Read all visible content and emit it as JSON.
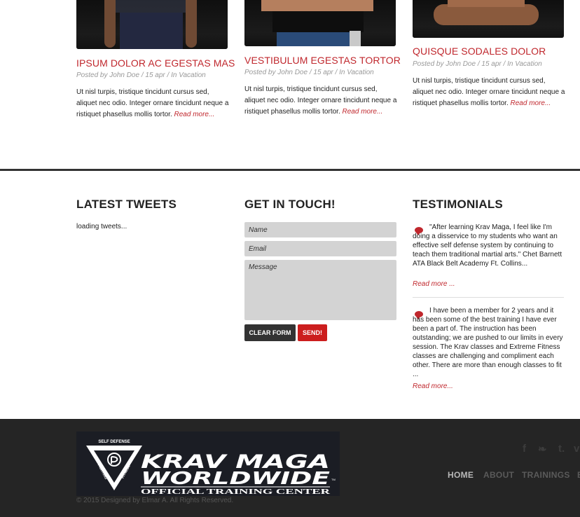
{
  "posts": [
    {
      "title": "IPSUM DOLOR AC EGESTAS MAS",
      "meta": "Posted by John Doe / 15 apr / In Vacation",
      "text": "Ut nisl turpis, tristique tincidunt cursus sed, aliquet nec odio. Integer ornare tincidunt neque a ristiquet phasellus mollis tortor.",
      "more": "Read more..."
    },
    {
      "title": "VESTIBULUM EGESTAS TORTOR",
      "meta": "Posted by John Doe / 15 apr / In Vacation",
      "text": "Ut nisl turpis, tristique tincidunt cursus sed, aliquet nec odio. Integer ornare tincidunt neque a ristiquet phasellus mollis tortor.",
      "more": "Read more..."
    },
    {
      "title": "QUISQUE SODALES DOLOR",
      "meta": "Posted by John Doe / 15 apr / In Vacation",
      "text": "Ut nisl turpis, tristique tincidunt cursus sed, aliquet nec odio. Integer ornare tincidunt neque a ristiquet phasellus mollis tortor.",
      "more": "Read more..."
    }
  ],
  "tweets": {
    "title": "LATEST TWEETS",
    "loading": "loading tweets..."
  },
  "contact": {
    "title": "GET IN TOUCH!",
    "name_placeholder": "Name",
    "email_placeholder": "Email",
    "message_placeholder": "Message",
    "clear_label": "CLEAR FORM",
    "send_label": "SEND!"
  },
  "testimonials": {
    "title": "TESTIMONIALS",
    "items": [
      {
        "text": "\"After learning Krav Maga, I feel like I'm doing a disservice to my students who want an effective self defense system by continuing to teach them traditional martial arts.\" Chet Barnett ATA Black Belt Academy Ft. Collins...",
        "more": "Read more ..."
      },
      {
        "text": "I have been a member for 2 years and it has been some of the best training I have ever been a part of. The instruction has been outstanding; we are pushed to our limits in every session. The Krav classes and Extreme Fitness classes are challenging and compliment each other. There are more than enough classes to fit ...",
        "more": "Read more..."
      }
    ]
  },
  "footer": {
    "logo": {
      "badge_top": "SELF DEFENSE",
      "badge_left": "FIGHTING",
      "badge_right": "FITNESS",
      "line1": "KRAV MAGA",
      "line2": "WORLDWIDE",
      "tm": "TM",
      "subtitle": "OFFICIAL TRAINING CENTER"
    },
    "copyright": "© 2015 Designed by Elmar A. All Rights Reserved.",
    "social": [
      {
        "icon": "facebook-icon",
        "glyph": "f"
      },
      {
        "icon": "twitter-icon",
        "glyph": "❧"
      },
      {
        "icon": "tumblr-icon",
        "glyph": "t."
      },
      {
        "icon": "vimeo-icon",
        "glyph": "v"
      }
    ],
    "nav": [
      "HOME",
      "ABOUT",
      "TRAININGS",
      "B"
    ],
    "nav_active": "HOME"
  },
  "colors": {
    "accent": "#c0272d",
    "send_button": "#cc1e1e",
    "footer_bg": "#252525",
    "divider": "#333333"
  }
}
